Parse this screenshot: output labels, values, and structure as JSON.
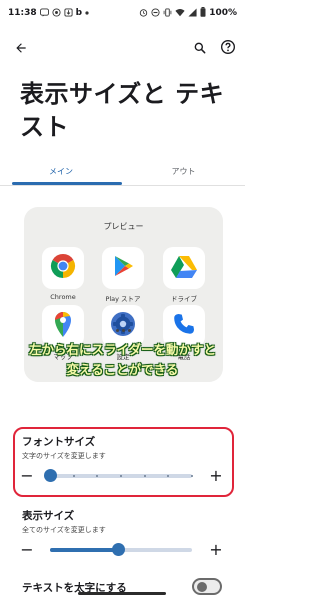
{
  "status_bar": {
    "time": "11:38",
    "battery": "100%",
    "left_icons": [
      "line-icon",
      "signal-icon",
      "download-icon",
      "b-icon",
      "notification-dot-icon"
    ],
    "right_icons": [
      "alarm-icon",
      "dnd-icon",
      "vibrate-icon",
      "wifi-icon",
      "signal-bars-icon",
      "battery-icon"
    ]
  },
  "top_bar": {
    "back_icon": "arrow-back-icon",
    "search_icon": "search-icon",
    "help_icon": "help-icon"
  },
  "page": {
    "title": "表示サイズと テキスト"
  },
  "tabs": {
    "items": [
      {
        "label": "メイン",
        "selected": true
      },
      {
        "label": "アウト",
        "selected": false
      }
    ]
  },
  "preview": {
    "title": "プレビュー",
    "apps": [
      {
        "label": "Chrome",
        "icon": "chrome-icon"
      },
      {
        "label": "Play ストア",
        "icon": "play-store-icon"
      },
      {
        "label": "ドライブ",
        "icon": "drive-icon"
      },
      {
        "label": "マップ",
        "icon": "maps-icon"
      },
      {
        "label": "設定",
        "icon": "settings-icon"
      },
      {
        "label": "電話",
        "icon": "phone-icon"
      }
    ],
    "page_count": 3
  },
  "annotation": {
    "line1": "左から右にスライダーを動かすと",
    "line2": "変えることができる",
    "color": "#f6f9a8",
    "outline_color": "#145c14"
  },
  "font_size": {
    "title": "フォントサイズ",
    "subtitle": "文字のサイズを変更します",
    "minus": "−",
    "plus": "+",
    "level": 0,
    "steps": 7
  },
  "display_size": {
    "title": "表示サイズ",
    "subtitle": "全てのサイズを変更します",
    "minus": "−",
    "plus": "+",
    "level": 0.48
  },
  "bold_text": {
    "label": "テキストを太字にする",
    "enabled": false
  },
  "colors": {
    "accent": "#2f6fb0",
    "highlight_border": "#e0253a",
    "preview_bg": "#eeeeec"
  }
}
